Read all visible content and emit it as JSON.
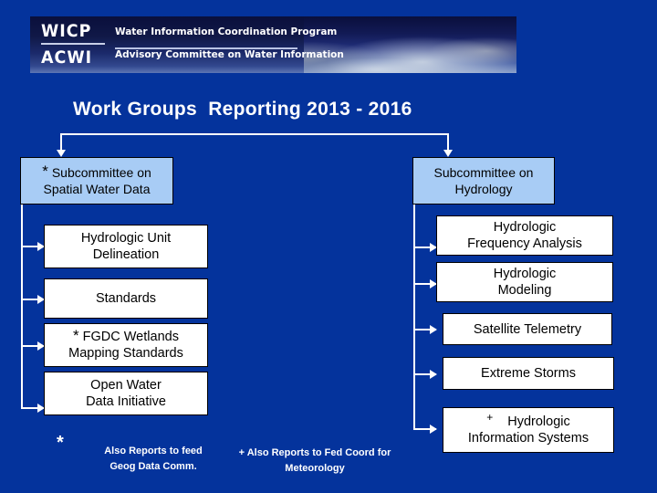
{
  "slide": {
    "background_color": "#04339c",
    "title": "Work Groups  Reporting 2013 - 2016"
  },
  "banner": {
    "logo_wicp": "WICP",
    "logo_acwi": "ACWI",
    "line1": "Water Information Coordination Program",
    "line2": "Advisory Committee on Water Information"
  },
  "columns": [
    {
      "id": "spatial-water-data",
      "header": {
        "marker": "*",
        "label": "Subcommittee on\nSpatial Water Data",
        "fill": "#a8ccf5"
      },
      "items": [
        {
          "marker": "",
          "label": "Hydrologic Unit\nDelineation"
        },
        {
          "marker": "",
          "label": "Standards"
        },
        {
          "marker": "*",
          "label": "FGDC Wetlands\nMapping Standards"
        },
        {
          "marker": "",
          "label": "Open Water\nData Initiative"
        }
      ]
    },
    {
      "id": "hydrology",
      "header": {
        "marker": "",
        "label": "Subcommittee on\nHydrology",
        "fill": "#a8ccf5"
      },
      "items": [
        {
          "marker": "",
          "label": "Hydrologic\nFrequency Analysis"
        },
        {
          "marker": "",
          "label": "Hydrologic\nModeling"
        },
        {
          "marker": "",
          "label": "Satellite Telemetry"
        },
        {
          "marker": "",
          "label": "Extreme Storms"
        },
        {
          "marker": "+",
          "label": "Hydrologic\nInformation Systems"
        }
      ]
    }
  ],
  "footnotes": [
    {
      "marker": "*",
      "text": "Also  Reports to feed\nGeog  Data  Comm."
    },
    {
      "marker": "+",
      "text": "+ Also  Reports to Fed  Coord for\nMeteorology"
    }
  ]
}
